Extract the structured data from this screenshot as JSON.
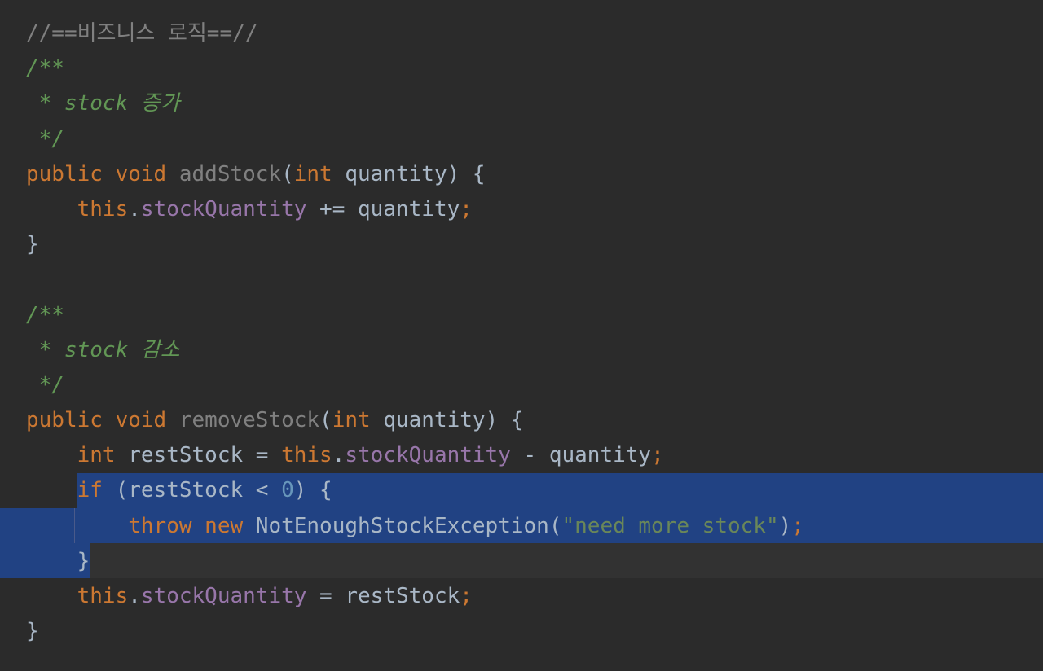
{
  "editor": {
    "lines": [
      [
        {
          "t": "//==비즈니스 로직==//",
          "c": "c-line"
        }
      ],
      [
        {
          "t": "/**",
          "c": "c-doc"
        }
      ],
      [
        {
          "t": " * stock 증가",
          "c": "c-doc"
        }
      ],
      [
        {
          "t": " */",
          "c": "c-doc"
        }
      ],
      [
        {
          "t": "public",
          "c": "kw"
        },
        {
          "t": " ",
          "c": "plain"
        },
        {
          "t": "void",
          "c": "kw"
        },
        {
          "t": " ",
          "c": "plain"
        },
        {
          "t": "addStock",
          "c": "fn"
        },
        {
          "t": "(",
          "c": "plain"
        },
        {
          "t": "int",
          "c": "kw"
        },
        {
          "t": " quantity) {",
          "c": "plain"
        }
      ],
      [
        {
          "t": "    ",
          "c": "plain"
        },
        {
          "t": "this",
          "c": "kw"
        },
        {
          "t": ".",
          "c": "plain"
        },
        {
          "t": "stockQuantity",
          "c": "field"
        },
        {
          "t": " += quantity",
          "c": "plain"
        },
        {
          "t": ";",
          "c": "semi"
        }
      ],
      [
        {
          "t": "}",
          "c": "plain"
        }
      ],
      [
        {
          "t": "",
          "c": "plain"
        }
      ],
      [
        {
          "t": "/**",
          "c": "c-doc"
        }
      ],
      [
        {
          "t": " * stock 감소",
          "c": "c-doc"
        }
      ],
      [
        {
          "t": " */",
          "c": "c-doc"
        }
      ],
      [
        {
          "t": "public",
          "c": "kw"
        },
        {
          "t": " ",
          "c": "plain"
        },
        {
          "t": "void",
          "c": "kw"
        },
        {
          "t": " ",
          "c": "plain"
        },
        {
          "t": "removeStock",
          "c": "fn"
        },
        {
          "t": "(",
          "c": "plain"
        },
        {
          "t": "int",
          "c": "kw"
        },
        {
          "t": " quantity) {",
          "c": "plain"
        }
      ],
      [
        {
          "t": "    ",
          "c": "plain"
        },
        {
          "t": "int",
          "c": "kw"
        },
        {
          "t": " restStock = ",
          "c": "plain"
        },
        {
          "t": "this",
          "c": "kw"
        },
        {
          "t": ".",
          "c": "plain"
        },
        {
          "t": "stockQuantity",
          "c": "field"
        },
        {
          "t": " - quantity",
          "c": "plain"
        },
        {
          "t": ";",
          "c": "semi"
        }
      ],
      [
        {
          "t": "    ",
          "c": "plain"
        },
        {
          "t": "if",
          "c": "kw"
        },
        {
          "t": " (restStock < ",
          "c": "plain"
        },
        {
          "t": "0",
          "c": "num"
        },
        {
          "t": ") {",
          "c": "plain"
        }
      ],
      [
        {
          "t": "        ",
          "c": "plain"
        },
        {
          "t": "throw",
          "c": "kw"
        },
        {
          "t": " ",
          "c": "plain"
        },
        {
          "t": "new",
          "c": "kw"
        },
        {
          "t": " NotEnoughStockException(",
          "c": "plain"
        },
        {
          "t": "\"need more stock\"",
          "c": "str"
        },
        {
          "t": ")",
          "c": "plain"
        },
        {
          "t": ";",
          "c": "semi"
        }
      ],
      [
        {
          "t": "    }",
          "c": "plain"
        }
      ],
      [
        {
          "t": "    ",
          "c": "plain"
        },
        {
          "t": "this",
          "c": "kw"
        },
        {
          "t": ".",
          "c": "plain"
        },
        {
          "t": "stockQuantity",
          "c": "field"
        },
        {
          "t": " = restStock",
          "c": "plain"
        },
        {
          "t": ";",
          "c": "semi"
        }
      ],
      [
        {
          "t": "}",
          "c": "plain"
        }
      ]
    ]
  }
}
